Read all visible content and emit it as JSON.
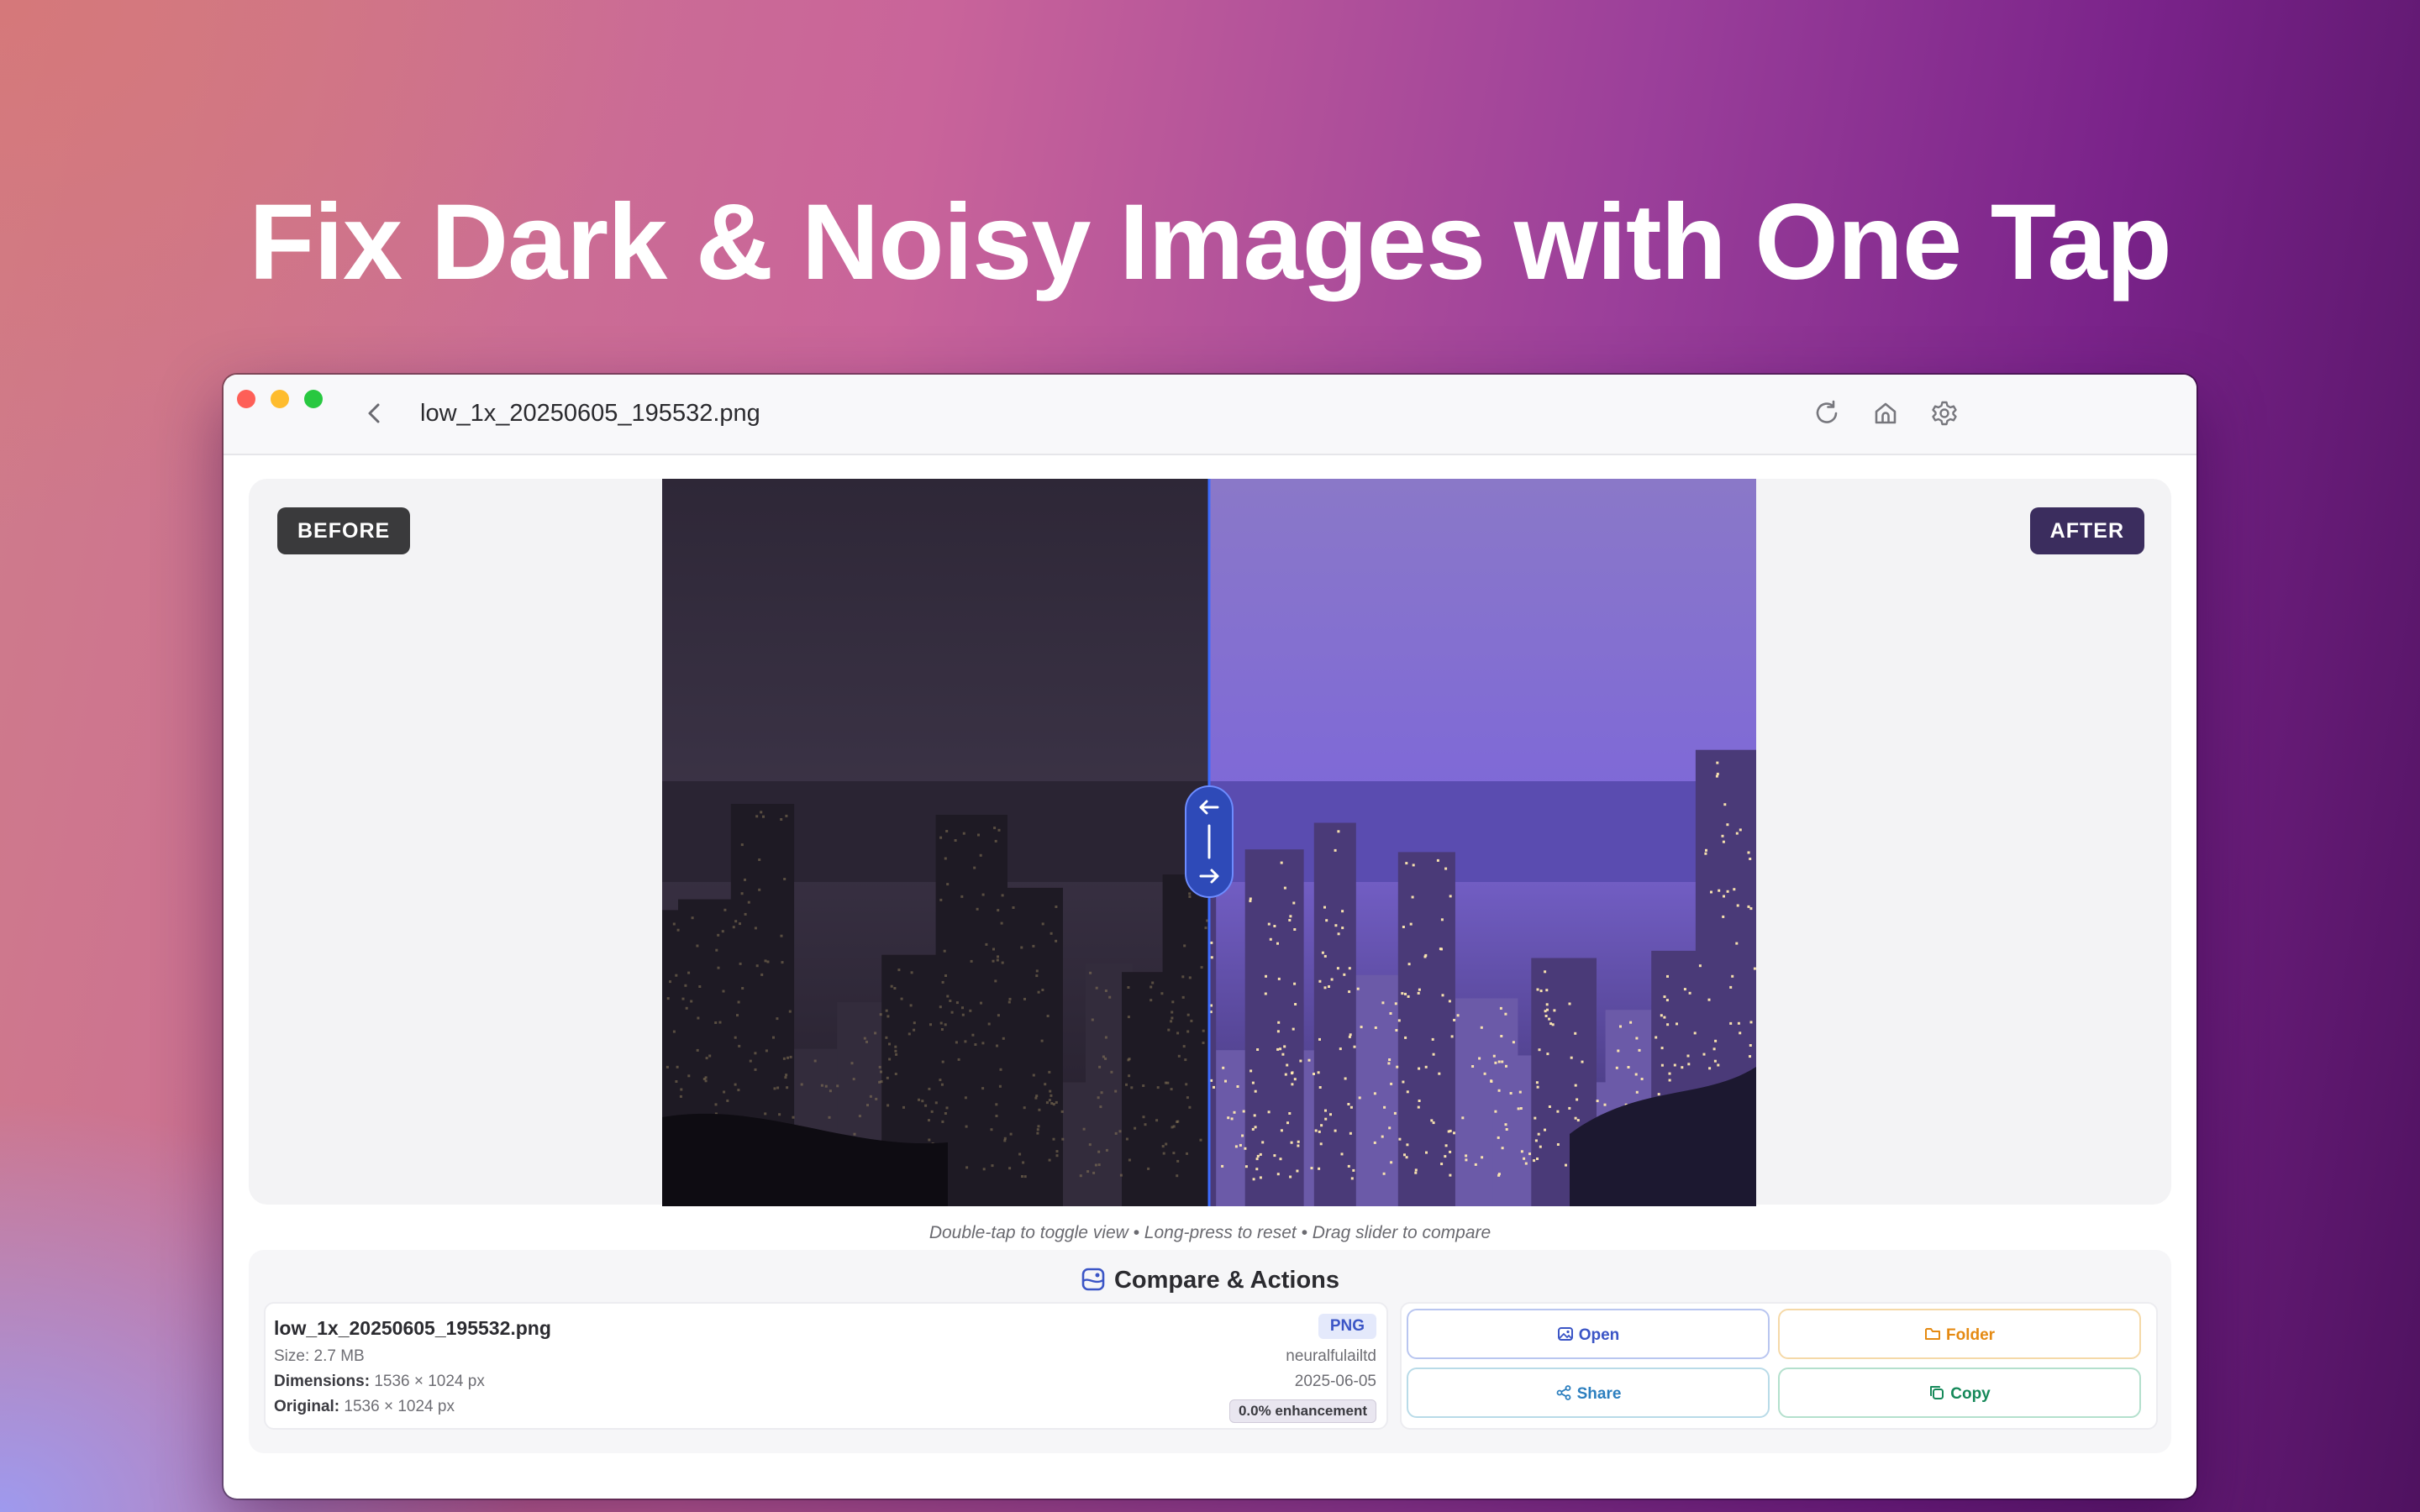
{
  "headline": "Fix Dark & Noisy Images with One Tap",
  "window": {
    "title": "low_1x_20250605_195532.png",
    "toolbar_icons": [
      "back-chevron-icon",
      "refresh-icon",
      "home-icon",
      "settings-gear-icon"
    ]
  },
  "viewer": {
    "before_label": "BEFORE",
    "after_label": "AFTER",
    "slider_position": 0.5,
    "hint": "Double-tap to toggle view • Long-press to reset • Drag slider to compare"
  },
  "actions": {
    "title": "Compare & Actions",
    "file": {
      "name": "low_1x_20250605_195532.png",
      "size_label": "Size:",
      "size_value": "2.7 MB",
      "dimensions_label": "Dimensions:",
      "dimensions_value": "1536 × 1024 px",
      "original_label": "Original:",
      "original_value": "1536 × 1024 px",
      "format": "PNG",
      "author": "neuralfulailtd",
      "date": "2025-06-05",
      "enhancement": "0.0% enhancement"
    },
    "buttons": {
      "open": "Open",
      "folder": "Folder",
      "share": "Share",
      "copy": "Copy"
    }
  },
  "colors": {
    "accent_blue": "#3b55c6",
    "folder_orange": "#e58a12",
    "share_blue": "#2c7fbf",
    "copy_green": "#16895a"
  }
}
